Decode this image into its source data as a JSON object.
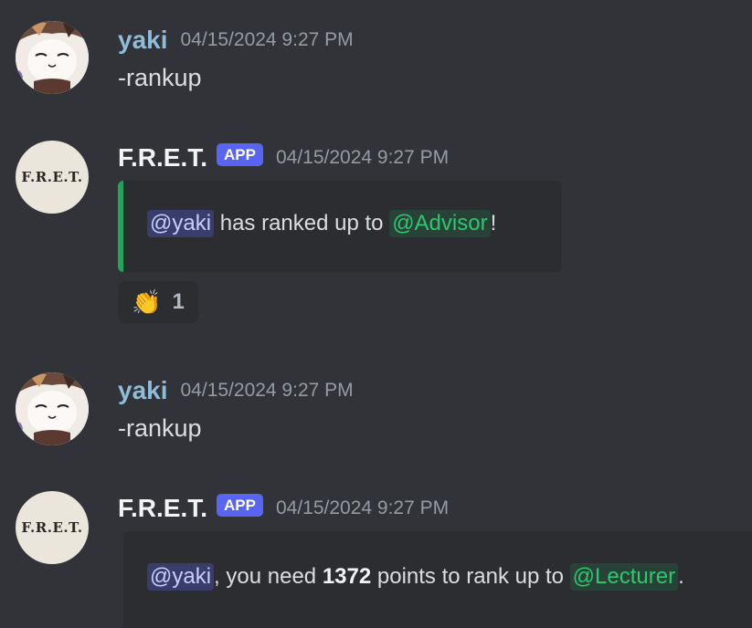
{
  "messages": [
    {
      "author": "yaki",
      "timestamp": "04/15/2024 9:27 PM",
      "text": "-rankup"
    },
    {
      "author": "F.R.E.T.",
      "badge": "APP",
      "avatar_text": "F.R.E.T.",
      "timestamp": "04/15/2024 9:27 PM",
      "embed": {
        "mention": "@yaki",
        "text_mid": " has ranked up to ",
        "role": "@Advisor",
        "text_end": "!",
        "accent_color": "#23a559"
      },
      "reaction": {
        "emoji": "👏",
        "emoji_name": "clapping-hands",
        "count": "1"
      }
    },
    {
      "author": "yaki",
      "timestamp": "04/15/2024 9:27 PM",
      "text": "-rankup"
    },
    {
      "author": "F.R.E.T.",
      "badge": "APP",
      "avatar_text": "F.R.E.T.",
      "timestamp": "04/15/2024 9:27 PM",
      "embed": {
        "mention": "@yaki",
        "text_pre": ", you need ",
        "points": "1372",
        "text_mid": " points to rank up to ",
        "role": "@Lecturer",
        "text_end": "."
      }
    }
  ],
  "colors": {
    "background": "#313338",
    "username_yaki": "#8fbcd6",
    "app_badge": "#5865f2",
    "role_green": "#2dc770"
  }
}
